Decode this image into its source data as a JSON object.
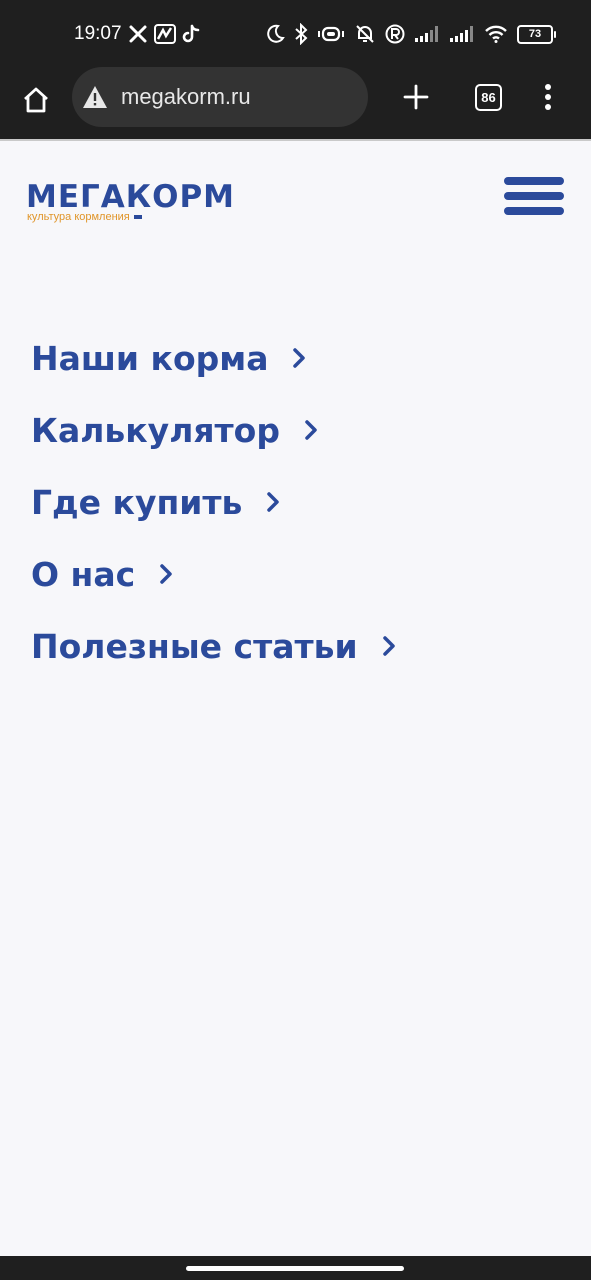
{
  "status_bar": {
    "time": "19:07",
    "battery": "73",
    "left_icons": [
      "x-icon",
      "app-icon",
      "tiktok-icon"
    ],
    "right_icons": [
      "moon-icon",
      "bluetooth-icon",
      "vibrate-icon",
      "alarm-off-icon",
      "registered-icon",
      "signal-icon",
      "signal-icon",
      "wifi-icon",
      "battery-icon"
    ]
  },
  "browser": {
    "url": "megakorm.ru",
    "tab_count": "86",
    "colors": {
      "toolbar": "#1f1f1f",
      "omnibox": "#333333"
    }
  },
  "page": {
    "logo": {
      "text": "МЕГАКОРМ",
      "tagline": "культура кормления"
    },
    "brand_color": "#2b4a9b",
    "accent_color": "#e0952a",
    "menu": [
      {
        "label": "Наши корма"
      },
      {
        "label": "Калькулятор"
      },
      {
        "label": "Где купить"
      },
      {
        "label": "О нас"
      },
      {
        "label": "Полезные статьи"
      }
    ]
  }
}
